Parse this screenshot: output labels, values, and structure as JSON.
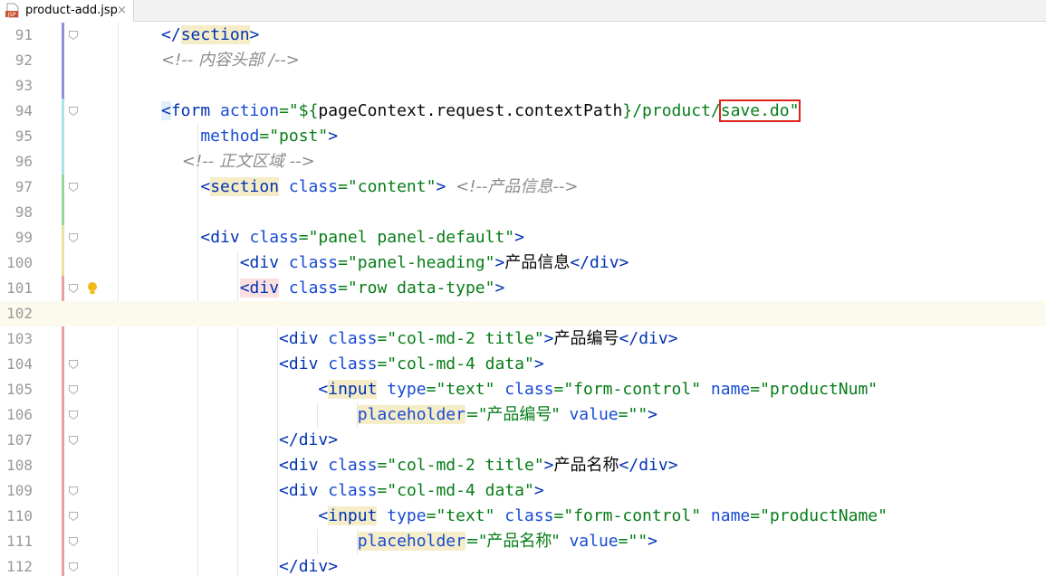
{
  "tab": {
    "filename": "product-add.jsp",
    "close": "×",
    "icon": "jsp-file-icon",
    "icon_text": "JSP"
  },
  "colors": {
    "tag": "#0033b3",
    "attr": "#174ad4",
    "value": "#067d17",
    "comment": "#8c8c8c",
    "highlight_box": "#e0201a"
  },
  "lines": [
    {
      "n": "91",
      "parts": [
        {
          "t": "</",
          "c": "t-tag"
        },
        {
          "t": "section",
          "c": "t-el hl"
        },
        {
          "t": ">",
          "c": "t-tag"
        }
      ]
    },
    {
      "n": "92",
      "parts": [
        {
          "t": "<!-- 内容头部 /-->",
          "c": "t-cmt"
        }
      ]
    },
    {
      "n": "93",
      "parts": []
    },
    {
      "n": "94",
      "parts": [
        {
          "t": "<",
          "c": "t-tag hl-blue"
        },
        {
          "t": "form",
          "c": "t-el"
        },
        {
          "t": " action",
          "c": "t-atr"
        },
        {
          "t": "=\"${",
          "c": "t-val"
        },
        {
          "t": "pageContext.request.contextPath",
          "c": ""
        },
        {
          "t": "}/product/",
          "c": "t-val"
        },
        {
          "t": "save.do\"",
          "c": "t-val boxed"
        }
      ]
    },
    {
      "n": "95",
      "parts": [
        {
          "t": "    method",
          "c": "t-atr"
        },
        {
          "t": "=\"post\"",
          "c": "t-val"
        },
        {
          "t": ">",
          "c": "t-tag"
        }
      ]
    },
    {
      "n": "96",
      "parts": [
        {
          "t": "    <!-- 正文区域 -->",
          "c": "t-cmt"
        }
      ]
    },
    {
      "n": "97",
      "parts": [
        {
          "t": "    <",
          "c": "t-tag"
        },
        {
          "t": "section",
          "c": "t-el hl"
        },
        {
          "t": " class",
          "c": "t-atr"
        },
        {
          "t": "=\"content\"",
          "c": "t-val"
        },
        {
          "t": "> ",
          "c": "t-tag"
        },
        {
          "t": "<!--产品信息-->",
          "c": "t-cmt"
        }
      ]
    },
    {
      "n": "98",
      "parts": []
    },
    {
      "n": "99",
      "parts": [
        {
          "t": "    <",
          "c": "t-tag"
        },
        {
          "t": "div",
          "c": "t-el"
        },
        {
          "t": " class",
          "c": "t-atr"
        },
        {
          "t": "=\"panel panel-default\"",
          "c": "t-val"
        },
        {
          "t": ">",
          "c": "t-tag"
        }
      ]
    },
    {
      "n": "100",
      "parts": [
        {
          "t": "        <",
          "c": "t-tag"
        },
        {
          "t": "div",
          "c": "t-el"
        },
        {
          "t": " class",
          "c": "t-atr"
        },
        {
          "t": "=\"panel-heading\"",
          "c": "t-val"
        },
        {
          "t": ">",
          "c": "t-tag"
        },
        {
          "t": "产品信息",
          "c": ""
        },
        {
          "t": "</",
          "c": "t-tag"
        },
        {
          "t": "div",
          "c": "t-el"
        },
        {
          "t": ">",
          "c": "t-tag"
        }
      ]
    },
    {
      "n": "101",
      "parts": [
        {
          "t": "        ",
          "c": ""
        },
        {
          "t": "<div",
          "c": "t-el hl-red"
        },
        {
          "t": " class",
          "c": "t-atr"
        },
        {
          "t": "=\"row data-type\"",
          "c": "t-val"
        },
        {
          "t": ">",
          "c": "t-tag"
        }
      ]
    },
    {
      "n": "102",
      "parts": []
    },
    {
      "n": "103",
      "parts": [
        {
          "t": "            <",
          "c": "t-tag"
        },
        {
          "t": "div",
          "c": "t-el"
        },
        {
          "t": " class",
          "c": "t-atr"
        },
        {
          "t": "=\"col-md-2 title\"",
          "c": "t-val"
        },
        {
          "t": ">",
          "c": "t-tag"
        },
        {
          "t": "产品编号",
          "c": ""
        },
        {
          "t": "</",
          "c": "t-tag"
        },
        {
          "t": "div",
          "c": "t-el"
        },
        {
          "t": ">",
          "c": "t-tag"
        }
      ]
    },
    {
      "n": "104",
      "parts": [
        {
          "t": "            <",
          "c": "t-tag"
        },
        {
          "t": "div",
          "c": "t-el"
        },
        {
          "t": " class",
          "c": "t-atr"
        },
        {
          "t": "=\"col-md-4 data\"",
          "c": "t-val"
        },
        {
          "t": ">",
          "c": "t-tag"
        }
      ]
    },
    {
      "n": "105",
      "parts": [
        {
          "t": "                <",
          "c": "t-tag"
        },
        {
          "t": "input",
          "c": "t-el hl"
        },
        {
          "t": " type",
          "c": "t-atr"
        },
        {
          "t": "=\"text\"",
          "c": "t-val"
        },
        {
          "t": " class",
          "c": "t-atr"
        },
        {
          "t": "=\"form-control\"",
          "c": "t-val"
        },
        {
          "t": " name",
          "c": "t-atr"
        },
        {
          "t": "=\"productNum\"",
          "c": "t-val"
        }
      ]
    },
    {
      "n": "106",
      "parts": [
        {
          "t": "                    ",
          "c": ""
        },
        {
          "t": "placeholder",
          "c": "t-atr hl"
        },
        {
          "t": "=\"产品编号\"",
          "c": "t-val"
        },
        {
          "t": " value",
          "c": "t-atr"
        },
        {
          "t": "=\"\"",
          "c": "t-val"
        },
        {
          "t": ">",
          "c": "t-tag"
        }
      ]
    },
    {
      "n": "107",
      "parts": [
        {
          "t": "            </",
          "c": "t-tag"
        },
        {
          "t": "div",
          "c": "t-el"
        },
        {
          "t": ">",
          "c": "t-tag"
        }
      ]
    },
    {
      "n": "108",
      "parts": [
        {
          "t": "            <",
          "c": "t-tag"
        },
        {
          "t": "div",
          "c": "t-el"
        },
        {
          "t": " class",
          "c": "t-atr"
        },
        {
          "t": "=\"col-md-2 title\"",
          "c": "t-val"
        },
        {
          "t": ">",
          "c": "t-tag"
        },
        {
          "t": "产品名称",
          "c": ""
        },
        {
          "t": "</",
          "c": "t-tag"
        },
        {
          "t": "div",
          "c": "t-el"
        },
        {
          "t": ">",
          "c": "t-tag"
        }
      ]
    },
    {
      "n": "109",
      "parts": [
        {
          "t": "            <",
          "c": "t-tag"
        },
        {
          "t": "div",
          "c": "t-el"
        },
        {
          "t": " class",
          "c": "t-atr"
        },
        {
          "t": "=\"col-md-4 data\"",
          "c": "t-val"
        },
        {
          "t": ">",
          "c": "t-tag"
        }
      ]
    },
    {
      "n": "110",
      "parts": [
        {
          "t": "                <",
          "c": "t-tag"
        },
        {
          "t": "input",
          "c": "t-el hl"
        },
        {
          "t": " type",
          "c": "t-atr"
        },
        {
          "t": "=\"text\"",
          "c": "t-val"
        },
        {
          "t": " class",
          "c": "t-atr"
        },
        {
          "t": "=\"form-control\"",
          "c": "t-val"
        },
        {
          "t": " name",
          "c": "t-atr"
        },
        {
          "t": "=\"productName\"",
          "c": "t-val"
        }
      ]
    },
    {
      "n": "111",
      "parts": [
        {
          "t": "                    ",
          "c": ""
        },
        {
          "t": "placeholder",
          "c": "t-atr hl"
        },
        {
          "t": "=\"产品名称\"",
          "c": "t-val"
        },
        {
          "t": " value",
          "c": "t-atr"
        },
        {
          "t": "=\"\"",
          "c": "t-val"
        },
        {
          "t": ">",
          "c": "t-tag"
        }
      ]
    },
    {
      "n": "112",
      "parts": [
        {
          "t": "            </",
          "c": "t-tag"
        },
        {
          "t": "div",
          "c": "t-el"
        },
        {
          "t": ">",
          "c": "t-tag"
        }
      ]
    }
  ],
  "fold_markers": [
    "91",
    "94",
    "97",
    "99",
    "101",
    "104",
    "105",
    "106",
    "107",
    "109",
    "110",
    "111",
    "112"
  ],
  "current_line": "102",
  "intention_bulb_line": "101"
}
